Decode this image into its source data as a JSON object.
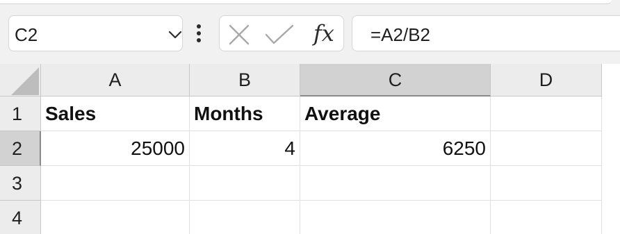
{
  "name_box": {
    "value": "C2",
    "dropdown_icon": "chevron-down-icon"
  },
  "formula_bar": {
    "more_icon": "vertical-ellipsis-icon",
    "cancel_icon": "x-icon",
    "enter_icon": "checkmark-icon",
    "function_label": "fx",
    "formula": "=A2/B2"
  },
  "columns": [
    "A",
    "B",
    "C",
    "D"
  ],
  "rows": [
    "1",
    "2",
    "3",
    "4"
  ],
  "selected_cell": {
    "column": "C",
    "row": "2"
  },
  "cells": {
    "A1": "Sales",
    "B1": "Months",
    "C1": "Average",
    "D1": "",
    "A2": "25000",
    "B2": "4",
    "C2": "6250",
    "D2": "",
    "A3": "",
    "B3": "",
    "C3": "",
    "D3": "",
    "A4": "",
    "B4": "",
    "C4": "",
    "D4": ""
  },
  "colors": {
    "header_background": "#ececec",
    "selected_header_background": "#d2d2d2",
    "gridline": "#e0e0e0"
  }
}
